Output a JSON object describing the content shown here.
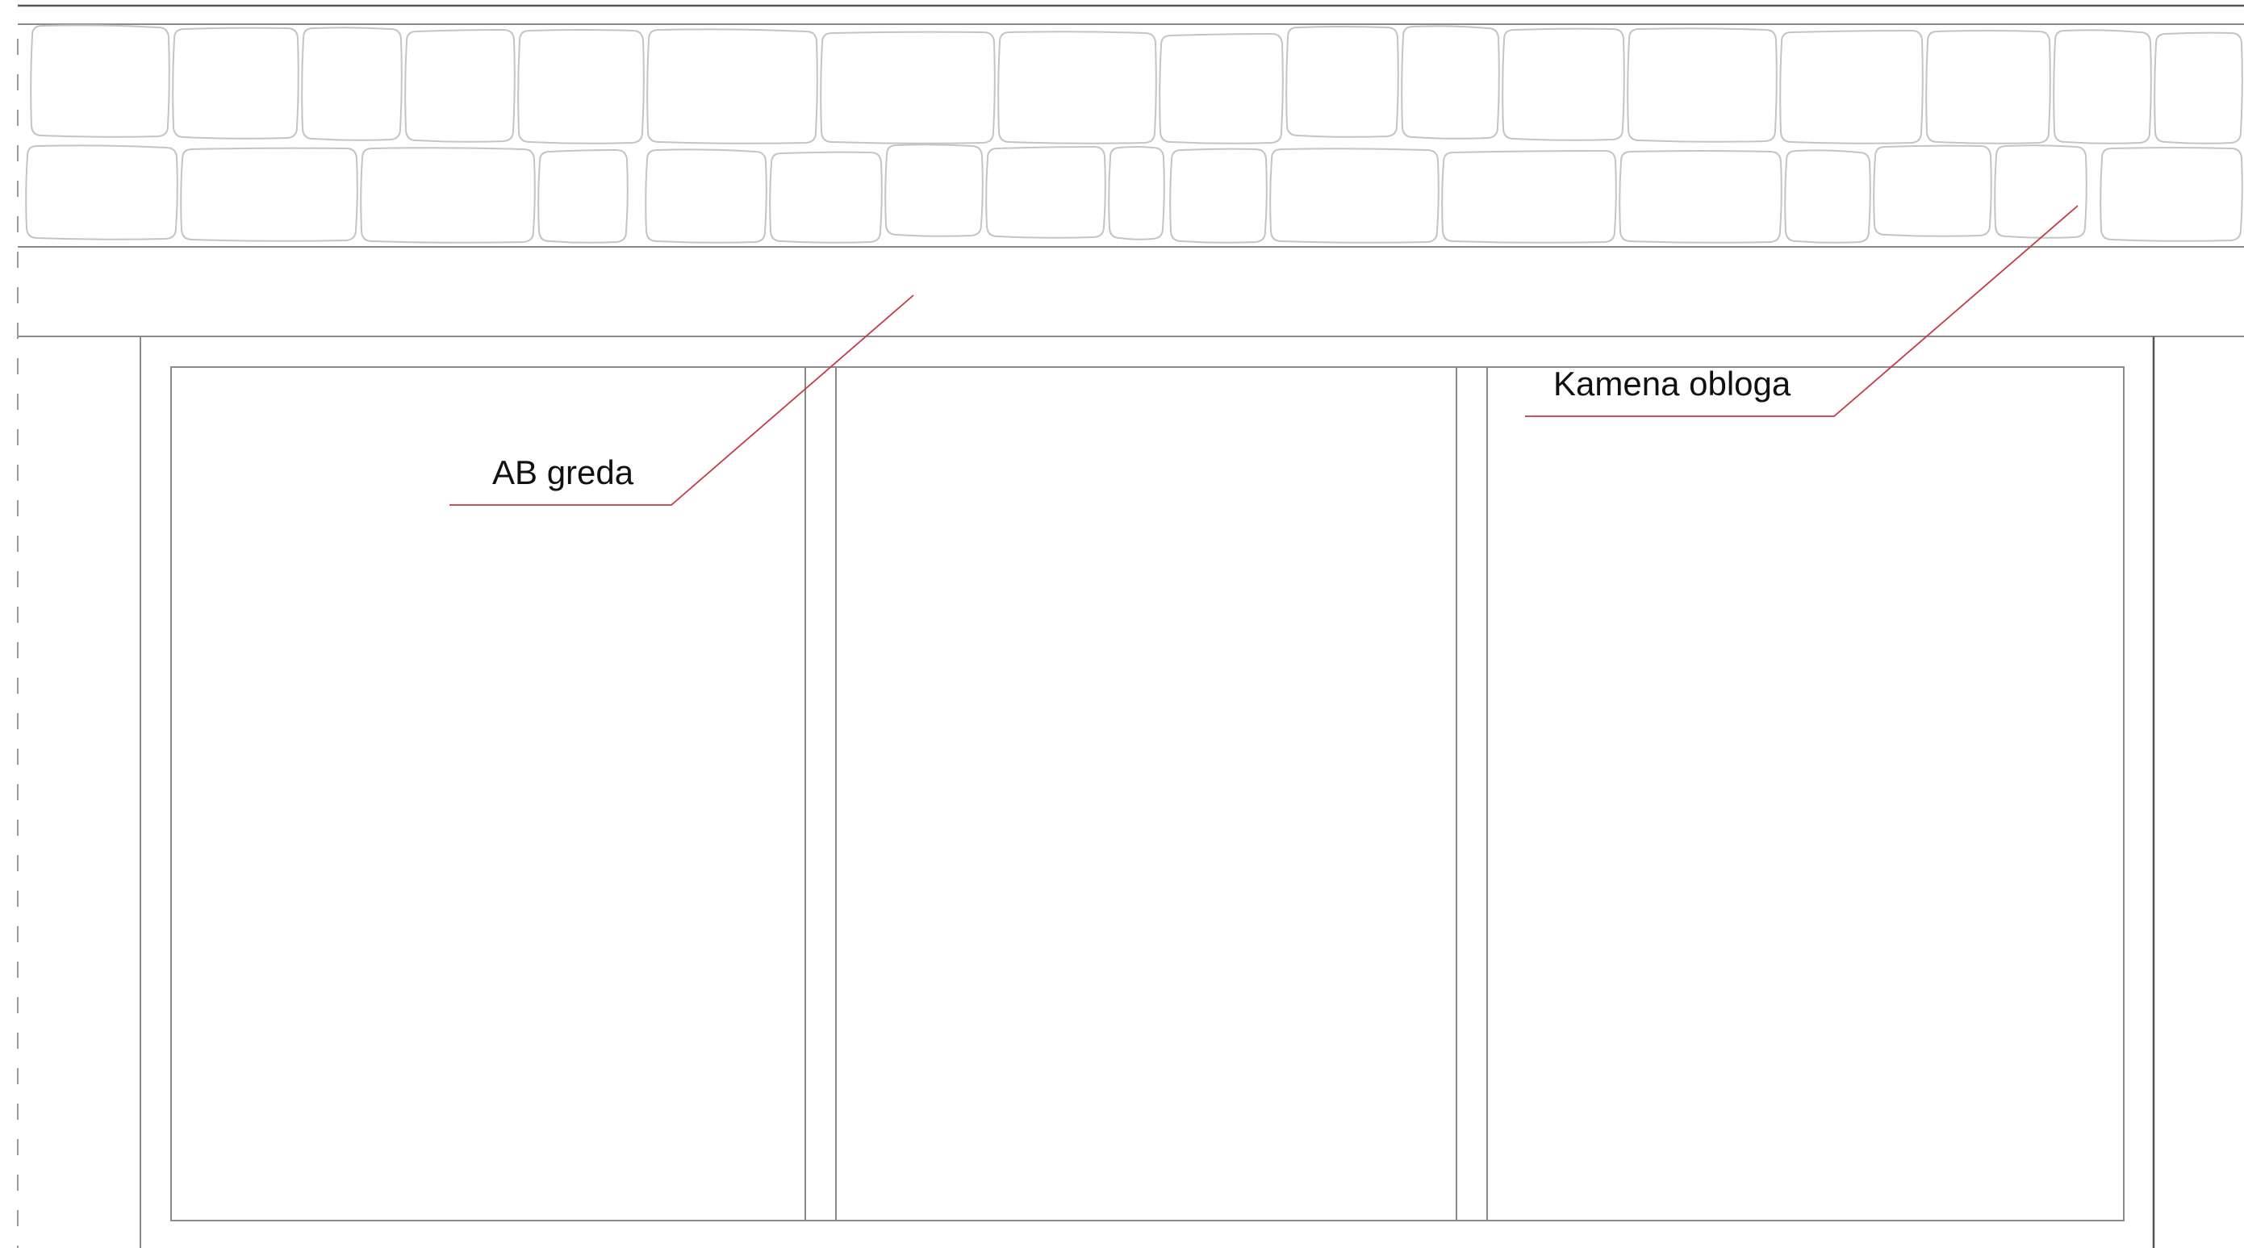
{
  "annotations": {
    "beam_label": "AB greda",
    "cladding_label": "Kamena obloga"
  },
  "colors": {
    "background": "#ffffff",
    "outline": "#8a8a8a",
    "stone_outline": "#c4c4c4",
    "leader_line": "#c43a48",
    "text": "#111111"
  }
}
